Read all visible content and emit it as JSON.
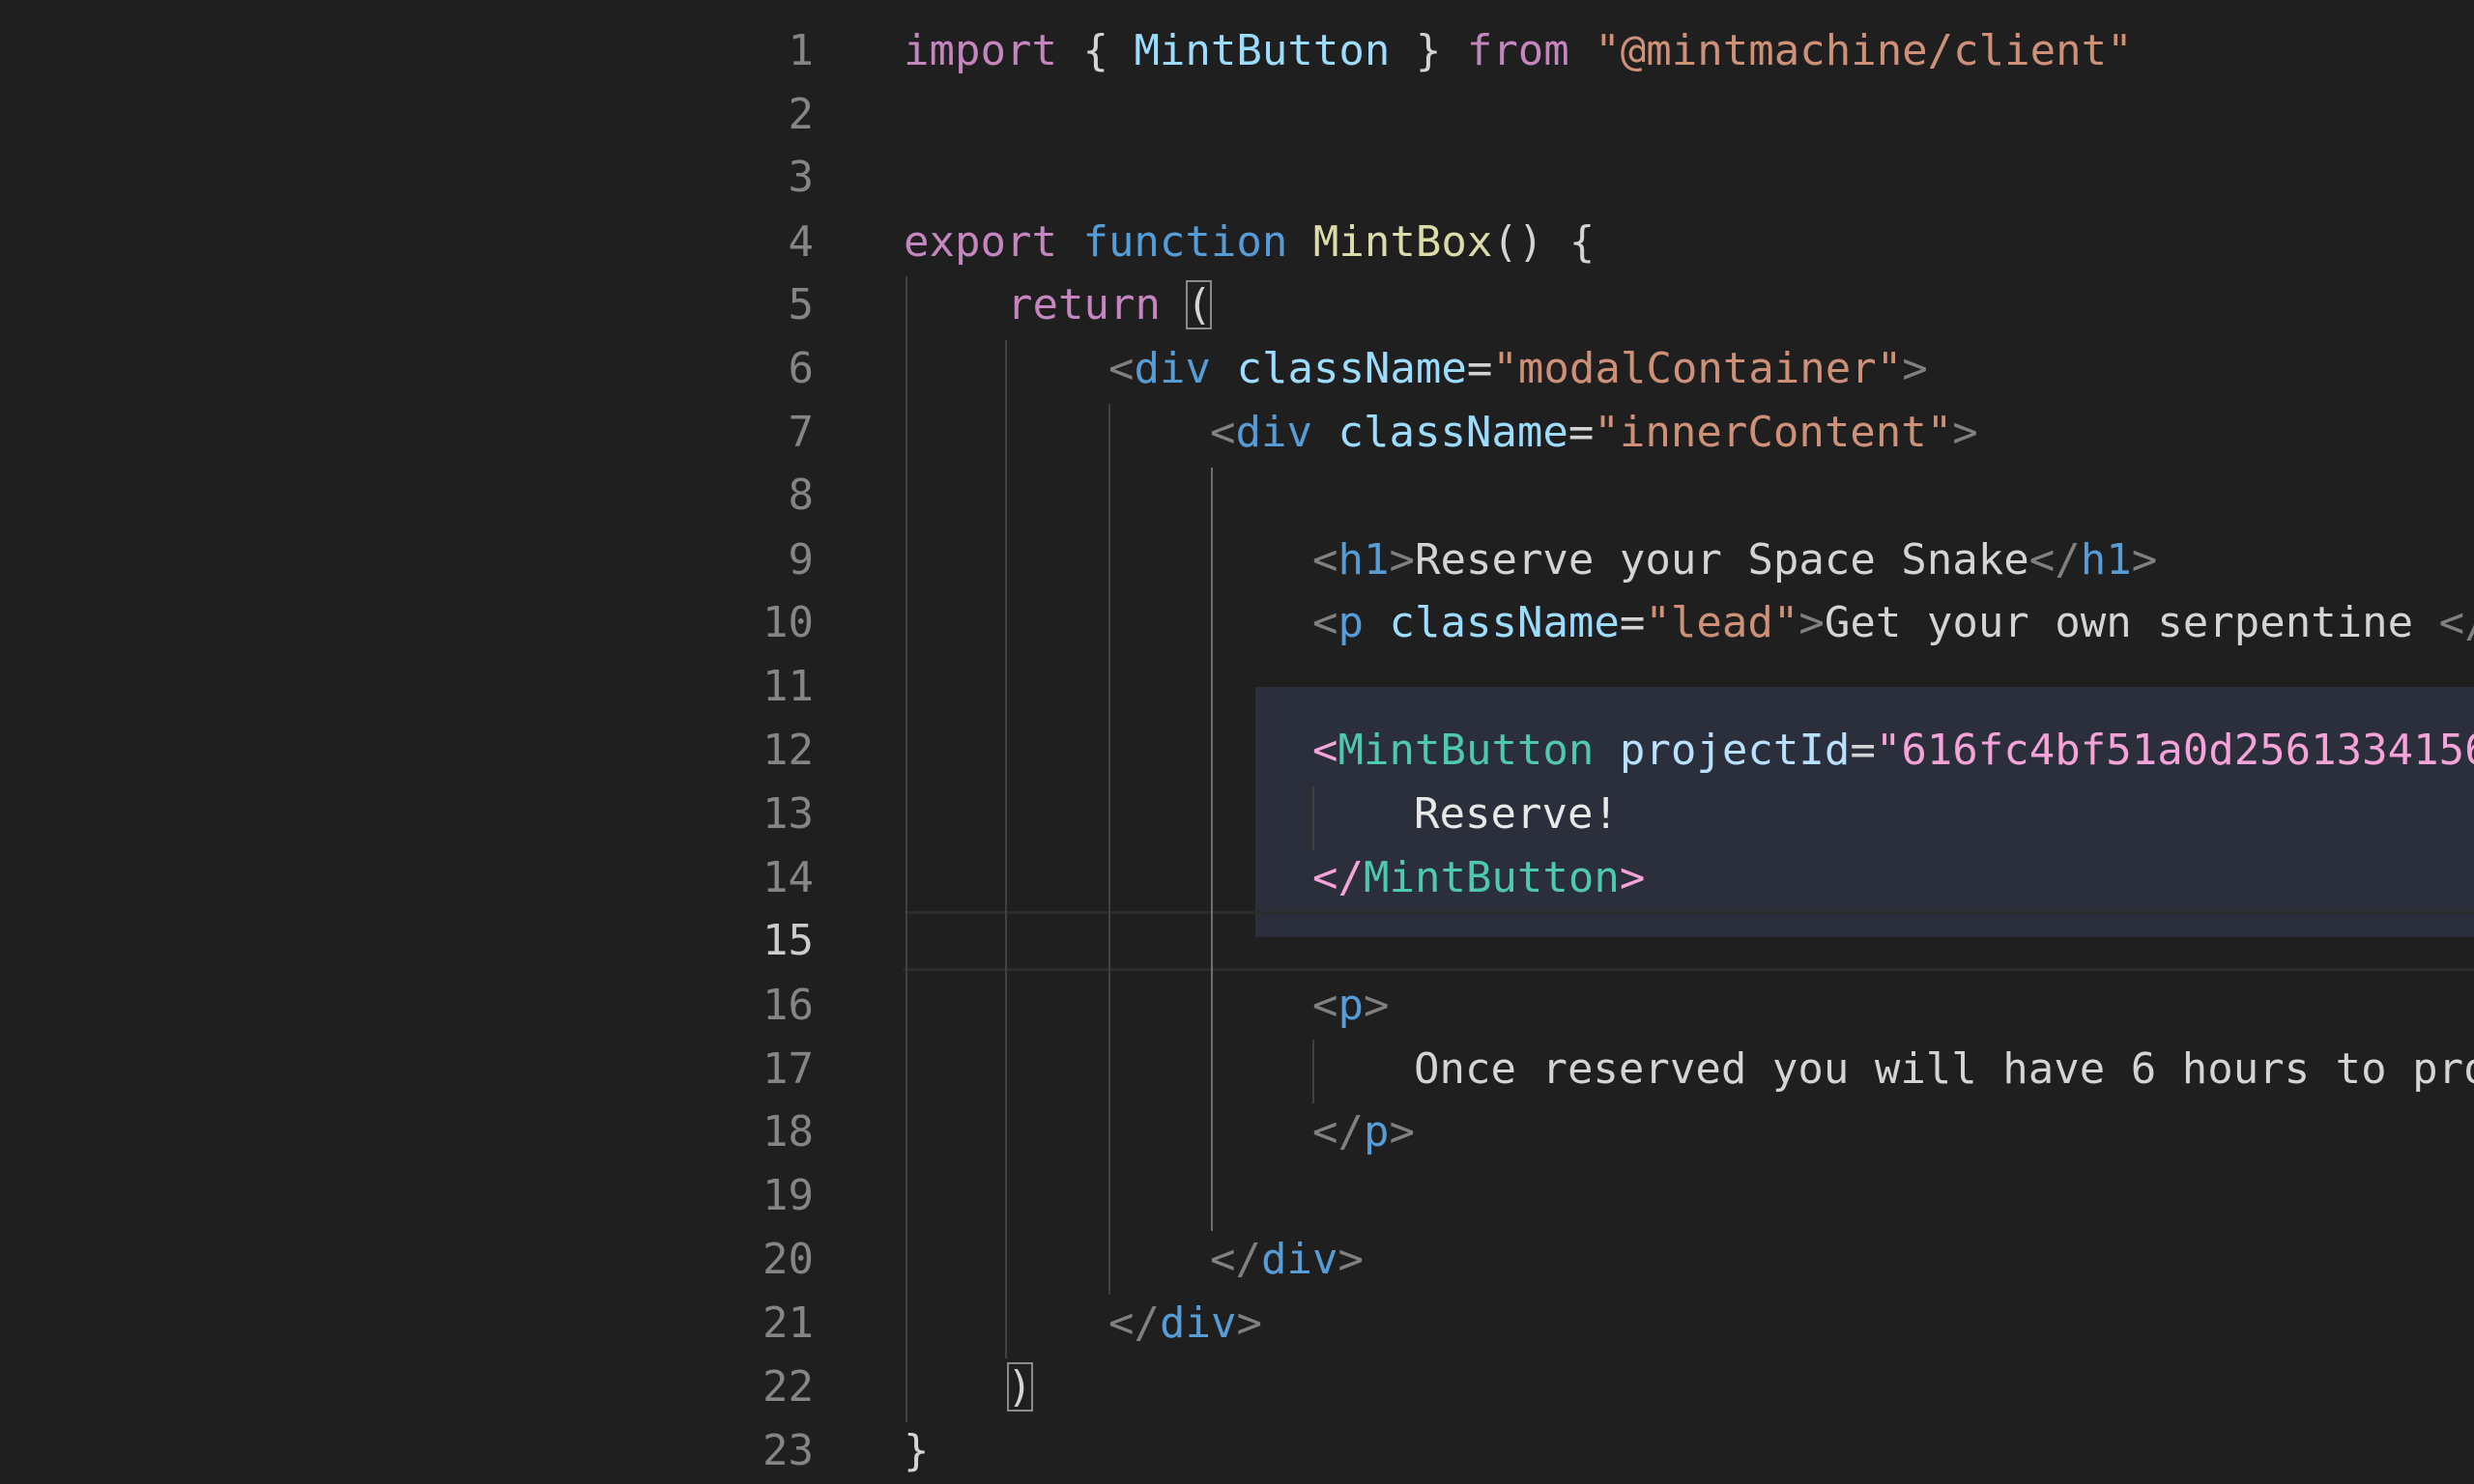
{
  "editor": {
    "line_numbers": [
      "1",
      "2",
      "3",
      "4",
      "5",
      "6",
      "7",
      "8",
      "9",
      "10",
      "11",
      "12",
      "13",
      "14",
      "15",
      "16",
      "17",
      "18",
      "19",
      "20",
      "21",
      "22",
      "23"
    ],
    "active_line": "15",
    "lines": {
      "l1": {
        "kw1": "import",
        "p1": " { ",
        "id": "MintButton",
        "p2": " } ",
        "kw2": "from",
        "p3": " ",
        "str": "\"@mintmachine/client\""
      },
      "l4": {
        "kw1": "export",
        "p1": " ",
        "kw2": "function",
        "p2": " ",
        "fn": "MintBox",
        "p3": "() {"
      },
      "l5": {
        "kw": "return",
        "p1": " ",
        "br": "("
      },
      "l6": {
        "lt": "<",
        "tag": "div",
        "sp": " ",
        "attr": "className",
        "eq": "=",
        "val": "\"modalContainer\"",
        "gt": ">"
      },
      "l7": {
        "lt": "<",
        "tag": "div",
        "sp": " ",
        "attr": "className",
        "eq": "=",
        "val": "\"innerContent\"",
        "gt": ">"
      },
      "l9": {
        "lt": "<",
        "tag": "h1",
        "gt": ">",
        "text": "Reserve your Space Snake",
        "lt2": "</",
        "tag2": "h1",
        "gt2": ">"
      },
      "l10": {
        "lt": "<",
        "tag": "p",
        "sp": " ",
        "attr": "className",
        "eq": "=",
        "val": "\"lead\"",
        "gt": ">",
        "text": "Get your own serpentine ",
        "lt2": "</"
      },
      "l12": {
        "lt": "<",
        "comp": "MintButton",
        "sp": " ",
        "attr": "projectId",
        "eq": "=",
        "val": "\"616fc4bf51a0d2561334156"
      },
      "l13": {
        "text": "Reserve!"
      },
      "l14": {
        "lt": "</",
        "comp": "MintButton",
        "gt": ">"
      },
      "l16": {
        "lt": "<",
        "tag": "p",
        "gt": ">"
      },
      "l17": {
        "text": "Once reserved you will have 6 hours to pro"
      },
      "l18": {
        "lt": "</",
        "tag": "p",
        "gt": ">"
      },
      "l20": {
        "lt": "</",
        "tag": "div",
        "gt": ">"
      },
      "l21": {
        "lt": "</",
        "tag": "div",
        "gt": ">"
      },
      "l22": {
        "br": ")"
      },
      "l23": {
        "br": "}"
      }
    }
  },
  "colors": {
    "background": "#1f1f1f",
    "keyword_control": "#c586c0",
    "keyword_declaration": "#569cd6",
    "identifier": "#9cdcfe",
    "function": "#dcdcaa",
    "string": "#ce9178",
    "component": "#4ec9b0",
    "line_number": "#858585",
    "highlight_block": "#2a2f3b"
  }
}
